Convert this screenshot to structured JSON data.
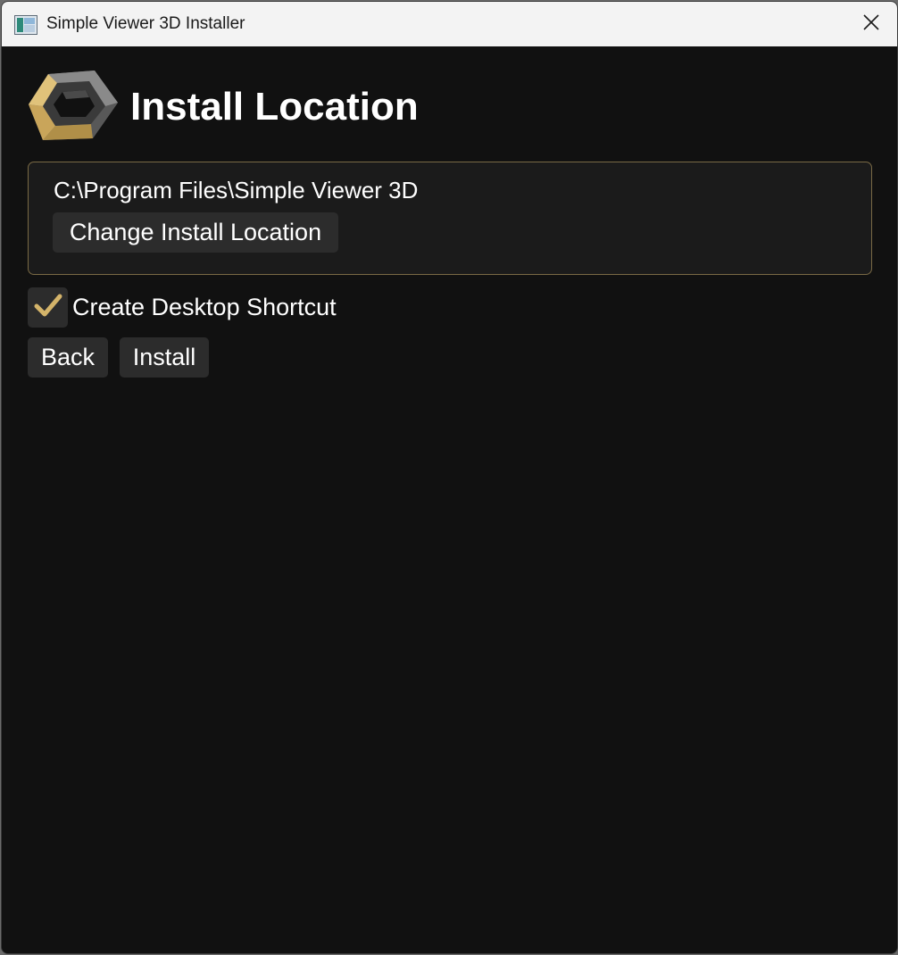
{
  "window": {
    "title": "Simple Viewer 3D Installer"
  },
  "header": {
    "title": "Install Location"
  },
  "install_location": {
    "path": "C:\\Program Files\\Simple Viewer 3D",
    "change_label": "Change Install Location"
  },
  "options": {
    "desktop_shortcut_label": "Create Desktop Shortcut",
    "desktop_shortcut_checked": true
  },
  "actions": {
    "back_label": "Back",
    "install_label": "Install"
  },
  "icons": {
    "app": "app-window-icon",
    "logo": "hexagon-ring-logo",
    "close": "close-icon",
    "check": "checkmark-icon"
  },
  "colors": {
    "background": "#111111",
    "panel": "#1b1b1b",
    "button": "#2c2c2c",
    "accent": "#d4b46a",
    "panel_border": "#7a6a45",
    "titlebar": "#f3f3f3"
  }
}
